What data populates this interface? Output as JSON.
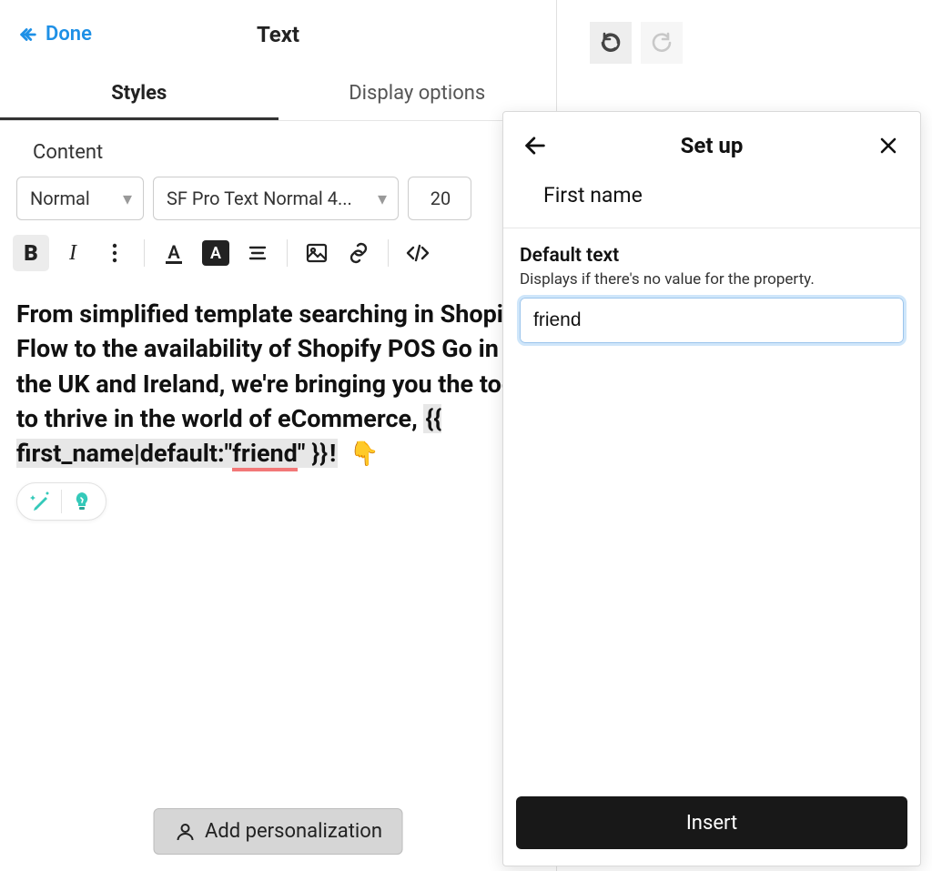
{
  "header": {
    "done_label": "Done",
    "title": "Text"
  },
  "tabs": {
    "styles": "Styles",
    "display_options": "Display options"
  },
  "content_section_label": "Content",
  "toolbar": {
    "format_select": "Normal",
    "font_select": "SF Pro Text Normal 4...",
    "size_select": "20"
  },
  "editor": {
    "body_prefix": "From simplified template searching in Shopify Flow to the availability of Shopify POS Go in the UK and Ireland, we're bringing you the tools to thrive in the world of eCommerce, ",
    "token_open": "{{ ",
    "token_var": "first_name",
    "token_pipe": "|default:",
    "token_quote1": "\"",
    "token_friend": "friend",
    "token_quote2": "\"",
    "token_close": " }}",
    "exclaim": "!",
    "emoji": "👇"
  },
  "add_personalization_label": "Add personalization",
  "popover": {
    "title": "Set up",
    "field_name": "First name",
    "default_text_label": "Default text",
    "default_text_help": "Displays if there's no value for the property.",
    "default_text_value": "friend",
    "insert_label": "Insert"
  }
}
